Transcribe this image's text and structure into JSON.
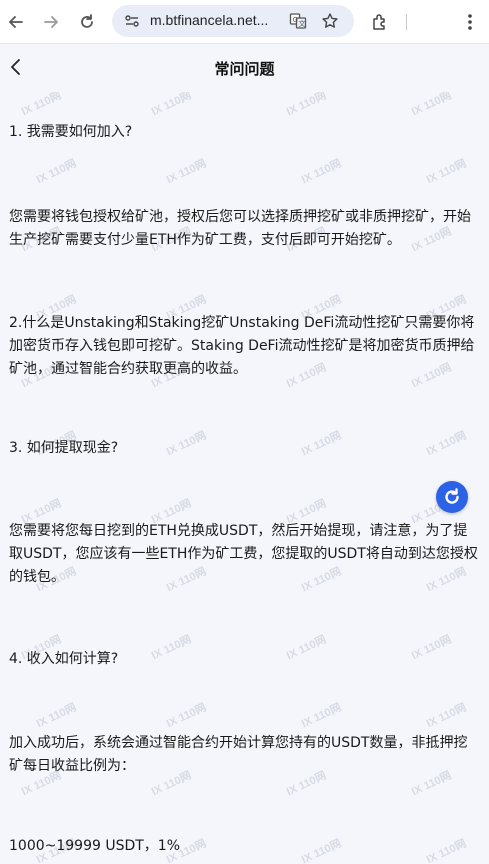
{
  "browser": {
    "url": "m.btfinancela.net...",
    "icons": [
      "back-arrow-icon",
      "forward-arrow-icon",
      "reload-icon",
      "site-settings-icon",
      "translate-icon",
      "star-icon",
      "extensions-icon",
      "menu-icon"
    ]
  },
  "header": {
    "title": "常问问题"
  },
  "faq": {
    "q1": "1. 我需要如何加入?",
    "a1": "您需要将钱包授权给矿池，授权后您可以选择质押挖矿或非质押挖矿，开始生产挖矿需要支付少量ETH作为矿工费，支付后即可开始挖矿。",
    "q2a2": "2.什么是Unstaking和Staking挖矿Unstaking DeFi流动性挖矿只需要你将加密货币存入钱包即可挖矿。Staking DeFi流动性挖矿是将加密货币质押给矿池，通过智能合约获取更高的收益。",
    "q3": "3. 如何提取现金?",
    "a3": "您需要将您每日挖到的ETH兑换成USDT，然后开始提现，请注意，为了提取USDT，您应该有一些ETH作为矿工费，您提取的USDT将自动到达您授权的钱包。",
    "q4": "4. 收入如何计算?",
    "a4": "加入成功后，系统会通过智能合约开始计算您持有的USDT数量，非抵押挖矿每日收益比例为：",
    "tier1": "1000~19999 USDT，1%"
  },
  "watermark_text": "IX 110网",
  "colors": {
    "background": "#f4f6fb",
    "accent": "#2c63e6"
  }
}
